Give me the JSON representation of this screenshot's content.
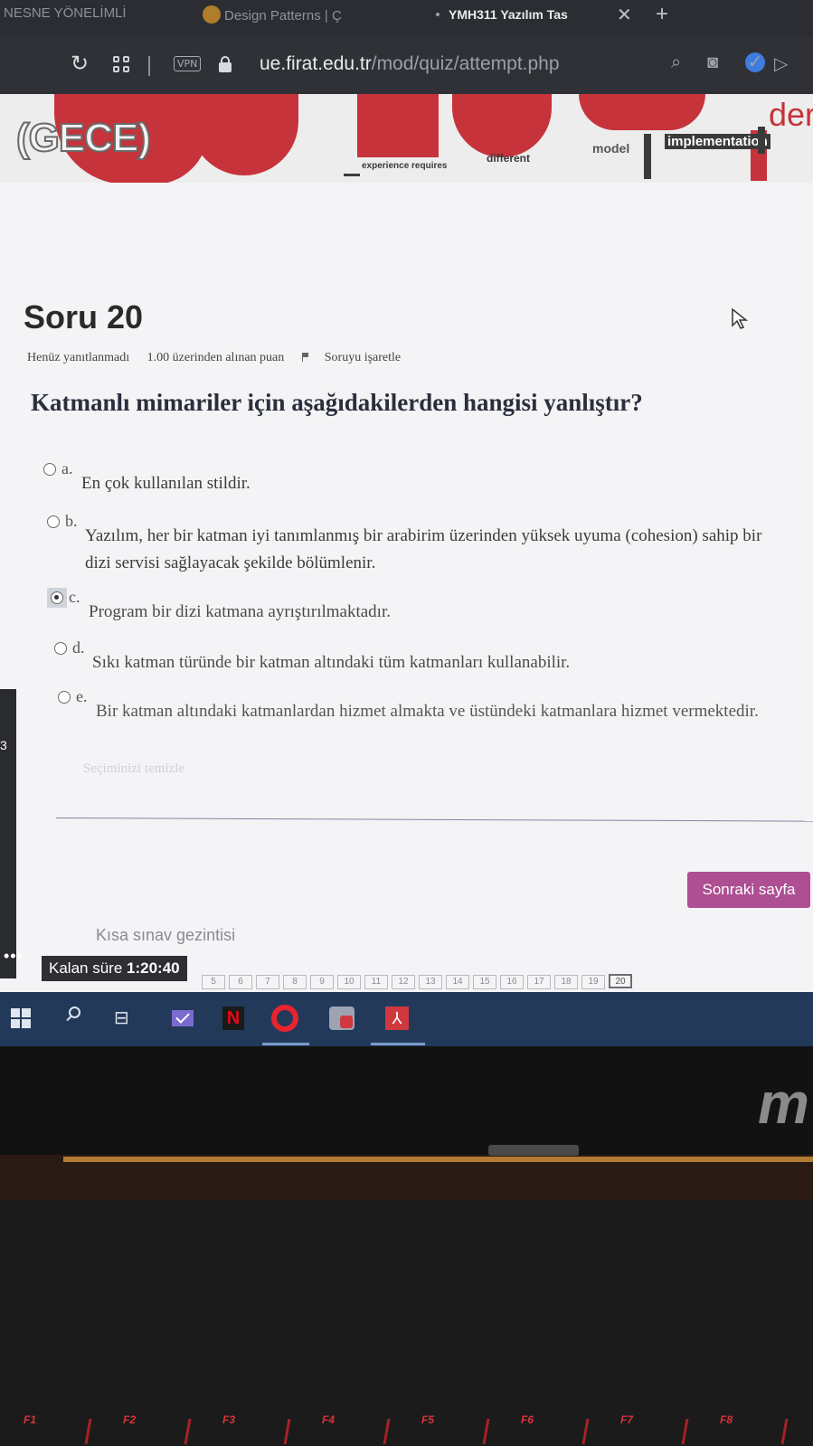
{
  "browser": {
    "tabs": [
      {
        "label": "NESNE YÖNELİMLİ"
      },
      {
        "label": "Design Patterns | Ç"
      },
      {
        "label": "YMH311 Yazılım Tas"
      }
    ],
    "vpn_label": "VPN",
    "url_host": "ue.firat.edu.tr",
    "url_path": "/mod/quiz/attempt.php"
  },
  "banner": {
    "course_suffix": "(GECE)",
    "words": [
      "experience requires",
      "different",
      "model",
      "implementation",
      "der"
    ]
  },
  "question": {
    "title": "Soru 20",
    "status": "Henüz yanıtlanmadı",
    "points": "1.00 üzerinden alınan puan",
    "flag_label": "Soruyu işaretle",
    "text": "Katmanlı mimariler için aşağıdakilerden hangisi yanlıştır?",
    "options": [
      {
        "letter": "a.",
        "text": "En çok kullanılan stildir.",
        "selected": false
      },
      {
        "letter": "b.",
        "text": "Yazılım, her bir katman iyi tanımlanmış bir arabirim üzerinden yüksek uyuma (cohesion) sahip bir dizi servisi sağlayacak şekilde bölümlenir.",
        "selected": false
      },
      {
        "letter": "c.",
        "text": "Program bir dizi katmana ayrıştırılmaktadır.",
        "selected": true
      },
      {
        "letter": "d.",
        "text": "Sıkı katman türünde bir katman altındaki tüm katmanları kullanabilir.",
        "selected": false
      },
      {
        "letter": "e.",
        "text": "Bir katman altındaki katmanlardan hizmet almakta ve üstündeki katmanlara hizmet vermektedir.",
        "selected": false
      }
    ],
    "clear_choice": "Seçiminizi temizle"
  },
  "navigation": {
    "next_label": "Sonraki sayfa",
    "quiz_nav_title": "Kısa sınav gezintisi",
    "timer_label": "Kalan süre",
    "timer_value": "1:20:40",
    "question_numbers": [
      "5",
      "6",
      "7",
      "8",
      "9",
      "10",
      "11",
      "12",
      "13",
      "14",
      "15",
      "16",
      "17",
      "18",
      "19",
      "20"
    ],
    "current_question": "20"
  },
  "sidebar": {
    "number": "3"
  },
  "keyboard": {
    "fkeys": [
      "F1",
      "F2",
      "F3",
      "F4",
      "F5",
      "F6",
      "F7",
      "F8"
    ]
  },
  "colors": {
    "accent_button": "#ad4f92",
    "banner_red": "#c7333a",
    "taskbar": "#23395a",
    "fkey_red": "#d8323a"
  }
}
